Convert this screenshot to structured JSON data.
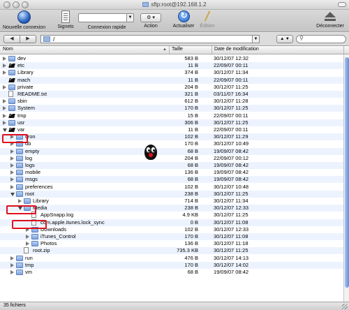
{
  "window": {
    "title": "sftp:root@192.168.1.2"
  },
  "toolbar": {
    "new_connection": "Nouvelle connexion",
    "bookmarks": "Signets",
    "quick_connect": "Connexion rapide",
    "action": "Action",
    "refresh": "Actualiser",
    "edit": "Édition",
    "disconnect": "Déconnecter"
  },
  "pathbar": {
    "back": "◀",
    "forward": "▶",
    "path": "/",
    "updown": "▲ ▼",
    "search_placeholder": ""
  },
  "columns": {
    "name": "Nom",
    "size": "Taille",
    "modified": "Date de modification",
    "sort_indicator": "▲"
  },
  "files": [
    {
      "name": "dev",
      "size": "583 B",
      "modified": "30/12/07 12:32",
      "type": "folder",
      "depth": 0,
      "state": "closed"
    },
    {
      "name": "etc",
      "size": "11 B",
      "modified": "22/09/07 00:11",
      "type": "link",
      "depth": 0,
      "state": "closed"
    },
    {
      "name": "Library",
      "size": "374 B",
      "modified": "30/12/07 11:34",
      "type": "folder",
      "depth": 0,
      "state": "closed"
    },
    {
      "name": "mach",
      "size": "11 B",
      "modified": "22/09/07 00:11",
      "type": "link",
      "depth": 0,
      "state": "none"
    },
    {
      "name": "private",
      "size": "204 B",
      "modified": "30/12/07 11:25",
      "type": "folder",
      "depth": 0,
      "state": "closed"
    },
    {
      "name": "README.txt",
      "size": "321 B",
      "modified": "03/11/07 16:34",
      "type": "file",
      "depth": 0,
      "state": "none"
    },
    {
      "name": "sbin",
      "size": "612 B",
      "modified": "30/12/07 11:28",
      "type": "folder",
      "depth": 0,
      "state": "closed"
    },
    {
      "name": "System",
      "size": "170 B",
      "modified": "30/12/07 11:25",
      "type": "folder",
      "depth": 0,
      "state": "closed"
    },
    {
      "name": "tmp",
      "size": "15 B",
      "modified": "22/09/07 00:11",
      "type": "link",
      "depth": 0,
      "state": "closed"
    },
    {
      "name": "usr",
      "size": "306 B",
      "modified": "30/12/07 11:25",
      "type": "folder",
      "depth": 0,
      "state": "closed"
    },
    {
      "name": "var",
      "size": "11 B",
      "modified": "22/09/07 00:11",
      "type": "link",
      "depth": 0,
      "state": "open"
    },
    {
      "name": "cron",
      "size": "102 B",
      "modified": "30/12/07 11:29",
      "type": "folder",
      "depth": 1,
      "state": "closed"
    },
    {
      "name": "db",
      "size": "170 B",
      "modified": "30/12/07 10:49",
      "type": "folder",
      "depth": 1,
      "state": "closed"
    },
    {
      "name": "empty",
      "size": "68 B",
      "modified": "19/09/07 08:42",
      "type": "folder",
      "depth": 1,
      "state": "closed"
    },
    {
      "name": "log",
      "size": "204 B",
      "modified": "22/09/07 00:12",
      "type": "folder",
      "depth": 1,
      "state": "closed"
    },
    {
      "name": "logs",
      "size": "68 B",
      "modified": "19/09/07 08:42",
      "type": "folder",
      "depth": 1,
      "state": "closed"
    },
    {
      "name": "mobile",
      "size": "136 B",
      "modified": "19/09/07 08:42",
      "type": "folder",
      "depth": 1,
      "state": "closed"
    },
    {
      "name": "msgs",
      "size": "68 B",
      "modified": "19/09/07 08:42",
      "type": "folder",
      "depth": 1,
      "state": "closed"
    },
    {
      "name": "preferences",
      "size": "102 B",
      "modified": "30/12/07 10:48",
      "type": "folder",
      "depth": 1,
      "state": "closed"
    },
    {
      "name": "root",
      "size": "238 B",
      "modified": "30/12/07 11:25",
      "type": "folder",
      "depth": 1,
      "state": "open"
    },
    {
      "name": "Library",
      "size": "714 B",
      "modified": "30/12/07 11:34",
      "type": "folder",
      "depth": 2,
      "state": "closed"
    },
    {
      "name": "Media",
      "size": "238 B",
      "modified": "30/12/07 12:33",
      "type": "folder",
      "depth": 2,
      "state": "open"
    },
    {
      "name": "AppSnapp.log",
      "size": "4.9 KB",
      "modified": "30/12/07 11:25",
      "type": "file",
      "depth": 3,
      "state": "none"
    },
    {
      "name": "com.apple.itunes.lock_sync",
      "size": "0 B",
      "modified": "30/12/07 11:08",
      "type": "file",
      "depth": 3,
      "state": "none"
    },
    {
      "name": "Downloads",
      "size": "102 B",
      "modified": "30/12/07 12:33",
      "type": "folder",
      "depth": 3,
      "state": "closed"
    },
    {
      "name": "iTunes_Control",
      "size": "170 B",
      "modified": "30/12/07 11:08",
      "type": "folder",
      "depth": 3,
      "state": "closed"
    },
    {
      "name": "Photos",
      "size": "136 B",
      "modified": "30/12/07 11:18",
      "type": "folder",
      "depth": 3,
      "state": "closed"
    },
    {
      "name": "root.zip",
      "size": "735.3 KB",
      "modified": "30/12/07 11:25",
      "type": "file",
      "depth": 2,
      "state": "none"
    },
    {
      "name": "run",
      "size": "476 B",
      "modified": "30/12/07 14:13",
      "type": "folder",
      "depth": 1,
      "state": "closed"
    },
    {
      "name": "tmp",
      "size": "170 B",
      "modified": "30/12/07 14:02",
      "type": "folder",
      "depth": 1,
      "state": "closed"
    },
    {
      "name": "vm",
      "size": "68 B",
      "modified": "19/09/07 08:42",
      "type": "folder",
      "depth": 1,
      "state": "closed"
    }
  ],
  "status": {
    "count": "35 fichiers"
  },
  "colors": {
    "highlight": "#e0101c",
    "row_alt": "#edf3fe",
    "folder": "#7fa3dc"
  }
}
